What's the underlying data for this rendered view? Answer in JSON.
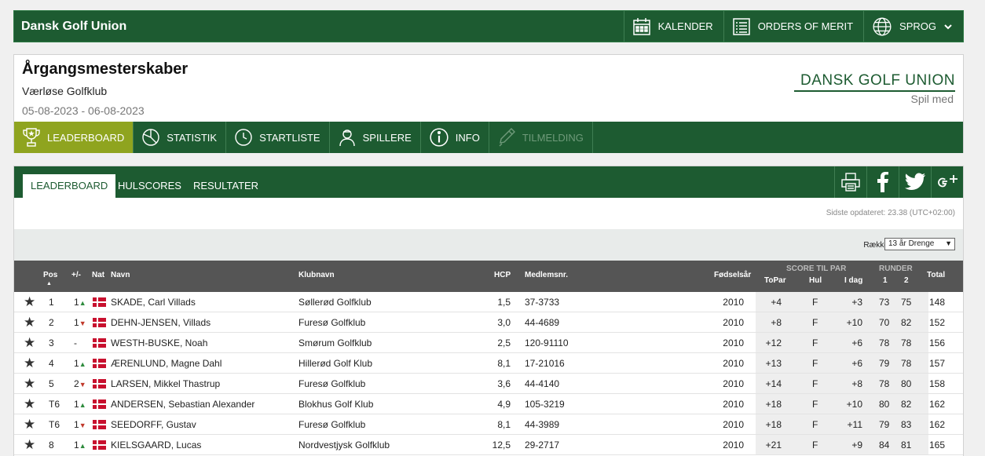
{
  "topbar": {
    "brand": "Dansk Golf Union",
    "nav": [
      {
        "label": "KALENDER",
        "icon": "calendar-icon"
      },
      {
        "label": "ORDERS OF MERIT",
        "icon": "list-icon"
      },
      {
        "label": "SPROG",
        "icon": "globe-icon"
      }
    ]
  },
  "event": {
    "title": "Årgangsmesterskaber",
    "club": "Værløse Golfklub",
    "dates": "05-08-2023 - 06-08-2023"
  },
  "logo": {
    "name": "DANSK GOLF UNION",
    "tagline": "Spil med"
  },
  "tabs": [
    {
      "label": "LEADERBOARD",
      "icon": "trophy-icon"
    },
    {
      "label": "STATISTIK",
      "icon": "pie-chart-icon"
    },
    {
      "label": "STARTLISTE",
      "icon": "clock-icon"
    },
    {
      "label": "SPILLERE",
      "icon": "person-icon"
    },
    {
      "label": "INFO",
      "icon": "info-icon"
    },
    {
      "label": "TILMELDING",
      "icon": "pencil-icon"
    }
  ],
  "subtabs": [
    "LEADERBOARD",
    "HULSCORES",
    "RESULTATER"
  ],
  "updated": "Sidste opdateret: 23.38 (UTC+02:00)",
  "filter": {
    "label": "Række",
    "selected": "13 år Drenge"
  },
  "columns": {
    "pos": "Pos",
    "change": "+/-",
    "nat": "Nat",
    "name": "Navn",
    "club": "Klubnavn",
    "hcp": "HCP",
    "member": "Medlemsnr.",
    "born": "Fødselsår",
    "score_group": "SCORE TIL PAR",
    "topar": "ToPar",
    "hul": "Hul",
    "today": "I dag",
    "rounds_group": "RUNDER",
    "r1": "1",
    "r2": "2",
    "total": "Total"
  },
  "rows": [
    {
      "pos": "1",
      "chg": "1",
      "dir": "▲",
      "name": "SKADE, Carl Villads",
      "club": "Søllerød Golfklub",
      "hcp": "1,5",
      "member": "37-3733",
      "born": "2010",
      "topar": "+4",
      "hul": "F",
      "today": "+3",
      "r1": "73",
      "r2": "75",
      "total": "148"
    },
    {
      "pos": "2",
      "chg": "1",
      "dir": "▼",
      "name": "DEHN-JENSEN, Villads",
      "club": "Furesø Golfklub",
      "hcp": "3,0",
      "member": "44-4689",
      "born": "2010",
      "topar": "+8",
      "hul": "F",
      "today": "+10",
      "r1": "70",
      "r2": "82",
      "total": "152"
    },
    {
      "pos": "3",
      "chg": "-",
      "dir": "",
      "name": "WESTH-BUSKE, Noah",
      "club": "Smørum Golfklub",
      "hcp": "2,5",
      "member": "120-91110",
      "born": "2010",
      "topar": "+12",
      "hul": "F",
      "today": "+6",
      "r1": "78",
      "r2": "78",
      "total": "156"
    },
    {
      "pos": "4",
      "chg": "1",
      "dir": "▲",
      "name": "ÆRENLUND, Magne Dahl",
      "club": "Hillerød Golf Klub",
      "hcp": "8,1",
      "member": "17-21016",
      "born": "2010",
      "topar": "+13",
      "hul": "F",
      "today": "+6",
      "r1": "79",
      "r2": "78",
      "total": "157"
    },
    {
      "pos": "5",
      "chg": "2",
      "dir": "▼",
      "name": "LARSEN, Mikkel Thastrup",
      "club": "Furesø Golfklub",
      "hcp": "3,6",
      "member": "44-4140",
      "born": "2010",
      "topar": "+14",
      "hul": "F",
      "today": "+8",
      "r1": "78",
      "r2": "80",
      "total": "158"
    },
    {
      "pos": "T6",
      "chg": "1",
      "dir": "▲",
      "name": "ANDERSEN, Sebastian Alexander",
      "club": "Blokhus Golf Klub",
      "hcp": "4,9",
      "member": "105-3219",
      "born": "2010",
      "topar": "+18",
      "hul": "F",
      "today": "+10",
      "r1": "80",
      "r2": "82",
      "total": "162"
    },
    {
      "pos": "T6",
      "chg": "1",
      "dir": "▼",
      "name": "SEEDORFF, Gustav",
      "club": "Furesø Golfklub",
      "hcp": "8,1",
      "member": "44-3989",
      "born": "2010",
      "topar": "+18",
      "hul": "F",
      "today": "+11",
      "r1": "79",
      "r2": "83",
      "total": "162"
    },
    {
      "pos": "8",
      "chg": "1",
      "dir": "▲",
      "name": "KIELSGAARD, Lucas",
      "club": "Nordvestjysk Golfklub",
      "hcp": "12,5",
      "member": "29-2717",
      "born": "2010",
      "topar": "+21",
      "hul": "F",
      "today": "+9",
      "r1": "84",
      "r2": "81",
      "total": "165"
    }
  ]
}
